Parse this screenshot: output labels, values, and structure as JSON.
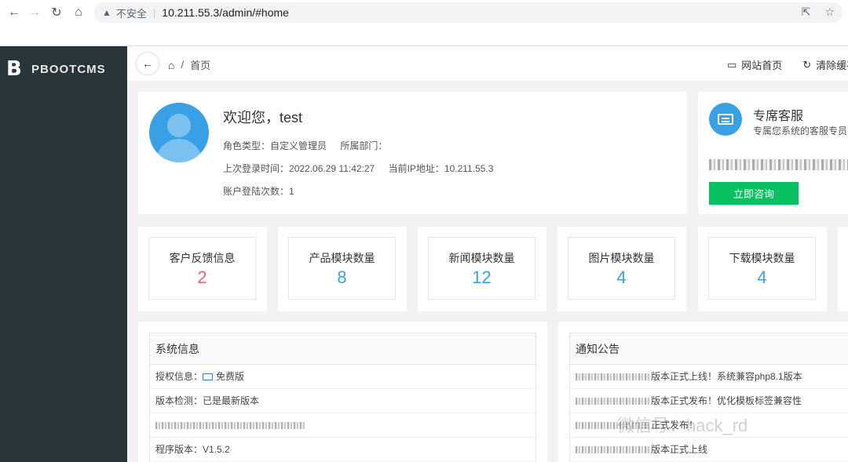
{
  "browser": {
    "insecure_label": "不安全",
    "url": "10.211.55.3/admin/#home"
  },
  "logo": {
    "text": "PBOOTCMS"
  },
  "breadcrumb": {
    "current": "首页"
  },
  "top_actions": {
    "site_home": "网站首页",
    "clear_cache": "清除缓存"
  },
  "welcome": {
    "title": "欢迎您，test",
    "role_label": "角色类型：",
    "role_value": "自定义管理员",
    "dept_label": "所属部门：",
    "dept_value": "",
    "last_login_label": "上次登录时间：",
    "last_login_value": "2022.06.29 11:42:27",
    "ip_label": "当前IP地址：",
    "ip_value": "10.211.55.3",
    "login_count_label": "账户登陆次数：",
    "login_count_value": "1"
  },
  "service": {
    "title": "专席客服",
    "subtitle": "专属您系统的客服专员",
    "button": "立即咨询"
  },
  "stats": [
    {
      "label": "客户反馈信息",
      "value": "2",
      "color": "#f5616f"
    },
    {
      "label": "产品模块数量",
      "value": "8",
      "color": "#3aa0e6"
    },
    {
      "label": "新闻模块数量",
      "value": "12",
      "color": "#3aa0e6"
    },
    {
      "label": "图片模块数量",
      "value": "4",
      "color": "#3aa0e6"
    },
    {
      "label": "下载模块数量",
      "value": "4",
      "color": "#3aa0e6"
    }
  ],
  "system_info": {
    "title": "系统信息",
    "license_label": "授权信息：",
    "license_value": "免费版",
    "version_check_label": "版本检测：",
    "version_check_value": "已是最新版本",
    "program_version_label": "程序版本：",
    "program_version_value": "V1.5.2"
  },
  "notices": {
    "title": "通知公告",
    "items": [
      "版本正式上线！系统兼容php8.1版本",
      "版本正式发布！优化模板标签兼容性",
      "正式发布！",
      "版本正式上线"
    ]
  },
  "watermark": "微信号：hack_rd"
}
